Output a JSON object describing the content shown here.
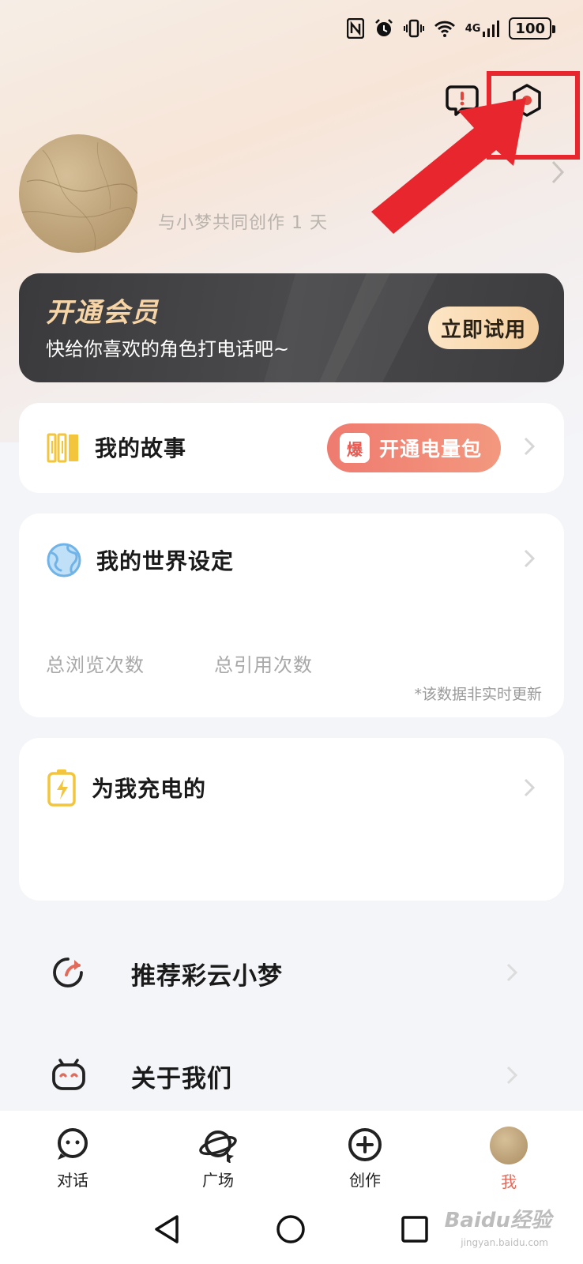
{
  "status_bar": {
    "icons": [
      "nfc-icon",
      "alarm-icon",
      "vibrate-icon",
      "wifi-icon",
      "signal-4g-icon"
    ],
    "network": "4G",
    "battery": "100"
  },
  "header": {
    "actions": [
      "feedback-icon",
      "settings-icon"
    ]
  },
  "profile": {
    "subtitle": "与小梦共同创作 1 天"
  },
  "vip": {
    "title": "开通会员",
    "subtitle": "快给你喜欢的角色打电话吧~",
    "button": "立即试用"
  },
  "cards": {
    "story": {
      "label": "我的故事",
      "badge": "爆",
      "button": "开通电量包"
    },
    "world": {
      "label": "我的世界设定",
      "stat_views": "总浏览次数",
      "stat_refs": "总引用次数",
      "note": "*该数据非实时更新"
    },
    "charge": {
      "label": "为我充电的"
    }
  },
  "list": {
    "recommend": "推荐彩云小梦",
    "about": "关于我们"
  },
  "tabs": [
    {
      "label": "对话",
      "icon": "chat-icon"
    },
    {
      "label": "广场",
      "icon": "plaza-icon"
    },
    {
      "label": "创作",
      "icon": "create-icon"
    },
    {
      "label": "我",
      "icon": "avatar"
    }
  ],
  "watermark": {
    "brand": "Baidu经验",
    "url": "jingyan.baidu.com"
  },
  "colors": {
    "accent": "#e26a5a",
    "highlight": "#e8262d",
    "vip_gold": "#f6d4a6"
  }
}
